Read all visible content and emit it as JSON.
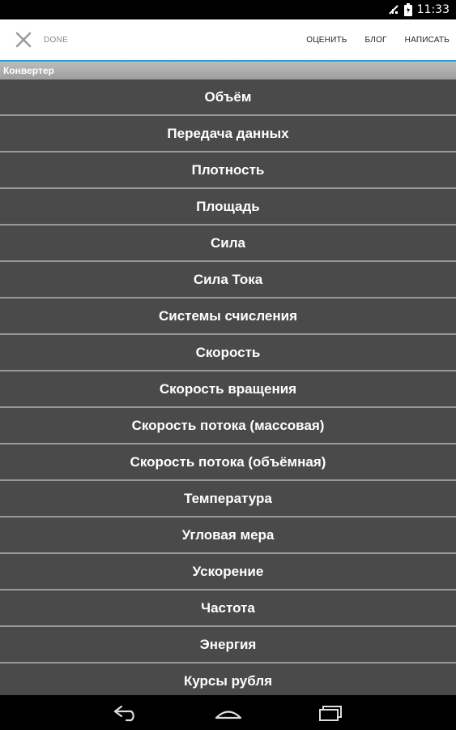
{
  "status_bar": {
    "time": "11:33"
  },
  "action_bar": {
    "done_label": "DONE",
    "actions": [
      "ОЦЕНИТЬ",
      "БЛОГ",
      "НАПИСАТЬ"
    ]
  },
  "section": {
    "title": "Конвертер"
  },
  "list": {
    "items": [
      "Объём",
      "Передача данных",
      "Плотность",
      "Площадь",
      "Сила",
      "Сила Тока",
      "Системы счисления",
      "Скорость",
      "Скорость вращения",
      "Скорость потока (массовая)",
      "Скорость потока (объёмная)",
      "Температура",
      "Угловая мера",
      "Ускорение",
      "Частота",
      "Энергия",
      "Курсы рубля"
    ]
  },
  "icons": {
    "close": "close-icon",
    "back": "back-icon",
    "home": "home-icon",
    "recent": "recent-apps-icon"
  },
  "colors": {
    "accent": "#2aa0d6",
    "list_bg": "#4a4a4a",
    "divider": "#9a9a9a"
  }
}
